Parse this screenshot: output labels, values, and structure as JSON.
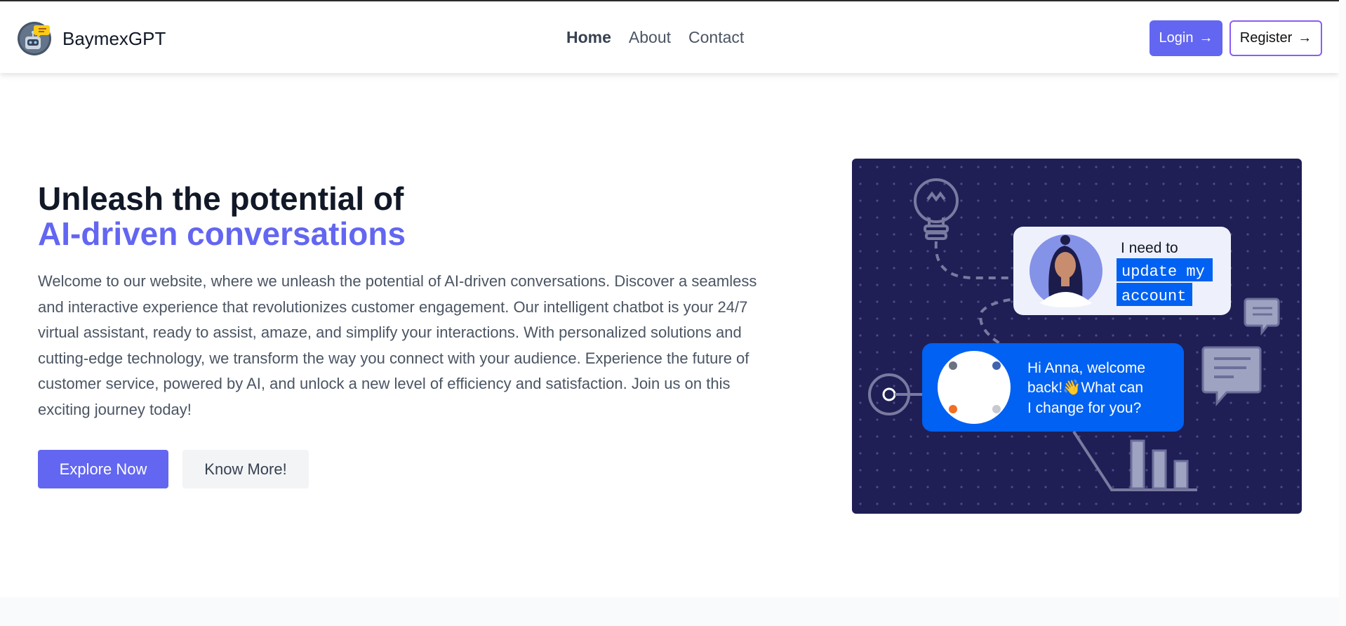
{
  "brand": {
    "name": "BaymexGPT",
    "logo_icon": "robot-chat-logo-icon"
  },
  "nav": {
    "links": [
      {
        "label": "Home",
        "active": true
      },
      {
        "label": "About",
        "active": false
      },
      {
        "label": "Contact",
        "active": false
      }
    ],
    "login_label": "Login",
    "register_label": "Register",
    "arrow_icon": "arrow-right-icon"
  },
  "hero": {
    "title_line1": "Unleash the potential of",
    "title_line2": "AI-driven conversations",
    "description": "Welcome to our website, where we unleash the potential of AI-driven conversations. Discover a seamless and interactive experience that revolutionizes customer engagement. Our intelligent chatbot is your 24/7 virtual assistant, ready to assist, amaze, and simplify your interactions. With personalized solutions and cutting-edge technology, we transform the way you connect with your audience. Experience the future of customer service, powered by AI, and unlock a new level of efficiency and satisfaction. Join us on this exciting journey today!",
    "primary_button": "Explore Now",
    "secondary_button": "Know More!"
  },
  "illustration": {
    "user_bubble_line1": "I need to",
    "user_bubble_highlight1": "update my",
    "user_bubble_highlight2": "account",
    "bot_bubble_line1": "Hi Anna, welcome",
    "bot_bubble_line2": "back!👋What can",
    "bot_bubble_line3": "I change for you?"
  },
  "colors": {
    "accent": "#6366f1",
    "register_border": "#8b5cf6",
    "illustration_bg": "#1f1f56",
    "bot_bubble": "#0061f2",
    "highlight": "#0061f2"
  }
}
